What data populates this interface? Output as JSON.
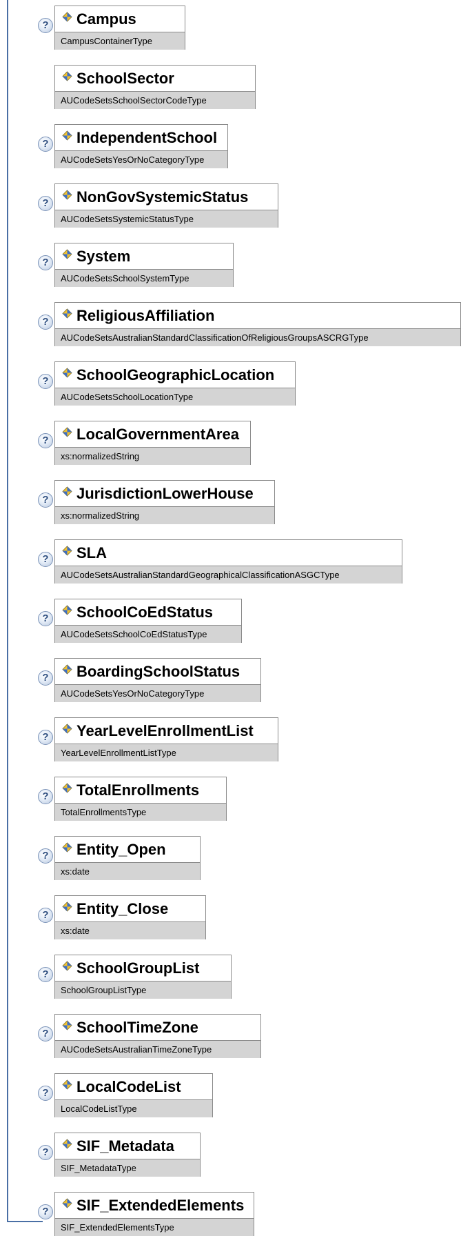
{
  "elements": [
    {
      "name": "Campus",
      "type": "CampusContainerType",
      "has_help": true
    },
    {
      "name": "SchoolSector",
      "type": "AUCodeSetsSchoolSectorCodeType",
      "has_help": false
    },
    {
      "name": "IndependentSchool",
      "type": "AUCodeSetsYesOrNoCategoryType",
      "has_help": true
    },
    {
      "name": "NonGovSystemicStatus",
      "type": "AUCodeSetsSystemicStatusType",
      "has_help": true
    },
    {
      "name": "System",
      "type": "AUCodeSetsSchoolSystemType",
      "has_help": true
    },
    {
      "name": "ReligiousAffiliation",
      "type": "AUCodeSetsAustralianStandardClassificationOfReligiousGroupsASCRGType",
      "has_help": true
    },
    {
      "name": "SchoolGeographicLocation",
      "type": "AUCodeSetsSchoolLocationType",
      "has_help": true
    },
    {
      "name": "LocalGovernmentArea",
      "type": "xs:normalizedString",
      "has_help": true
    },
    {
      "name": "JurisdictionLowerHouse",
      "type": "xs:normalizedString",
      "has_help": true
    },
    {
      "name": "SLA",
      "type": "AUCodeSetsAustralianStandardGeographicalClassificationASGCType",
      "has_help": true
    },
    {
      "name": "SchoolCoEdStatus",
      "type": "AUCodeSetsSchoolCoEdStatusType",
      "has_help": true
    },
    {
      "name": "BoardingSchoolStatus",
      "type": "AUCodeSetsYesOrNoCategoryType",
      "has_help": true
    },
    {
      "name": "YearLevelEnrollmentList",
      "type": "YearLevelEnrollmentListType",
      "has_help": true
    },
    {
      "name": "TotalEnrollments",
      "type": "TotalEnrollmentsType",
      "has_help": true
    },
    {
      "name": "Entity_Open",
      "type": "xs:date",
      "has_help": true
    },
    {
      "name": "Entity_Close",
      "type": "xs:date",
      "has_help": true
    },
    {
      "name": "SchoolGroupList",
      "type": "SchoolGroupListType",
      "has_help": true
    },
    {
      "name": "SchoolTimeZone",
      "type": "AUCodeSetsAustralianTimeZoneType",
      "has_help": true
    },
    {
      "name": "LocalCodeList",
      "type": "LocalCodeListType",
      "has_help": true
    },
    {
      "name": "SIF_Metadata",
      "type": "SIF_MetadataType",
      "has_help": true
    },
    {
      "name": "SIF_ExtendedElements",
      "type": "SIF_ExtendedElementsType",
      "has_help": true
    }
  ],
  "help_glyph": "?",
  "icons": {
    "help": "help-icon",
    "element": "element-diamond-icon"
  },
  "colors": {
    "connector": "#4a6fa5",
    "type_band": "#d4d4d4",
    "border": "#8a8a8a"
  }
}
